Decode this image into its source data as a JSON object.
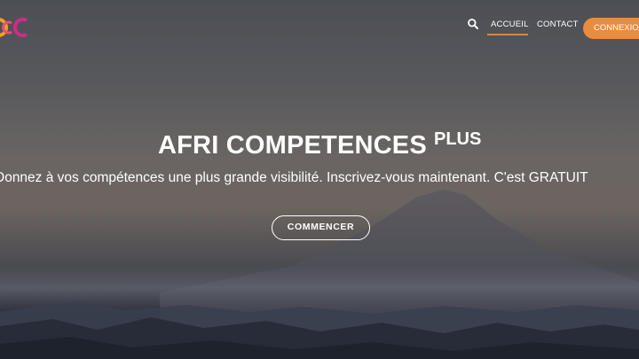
{
  "nav": {
    "search_icon": "search-icon",
    "items": [
      {
        "label": "ACCUEIL",
        "active": true
      },
      {
        "label": "CONTACT",
        "active": false
      }
    ],
    "login_label": "CONNEXION"
  },
  "hero": {
    "title": "AFRI COMPETENCES",
    "title_sup": "PLUS",
    "tagline": "Donnez à vos compétences une plus grande visibilité. Inscrivez-vous maintenant. C'est GRATUIT",
    "cta_label": "COMMENCER"
  },
  "colors": {
    "accent": "#e98c3d",
    "active_underline": "#e0853b",
    "logo_magenta": "#d12a86",
    "logo_orange": "#f0a020",
    "text": "#ffffff"
  }
}
